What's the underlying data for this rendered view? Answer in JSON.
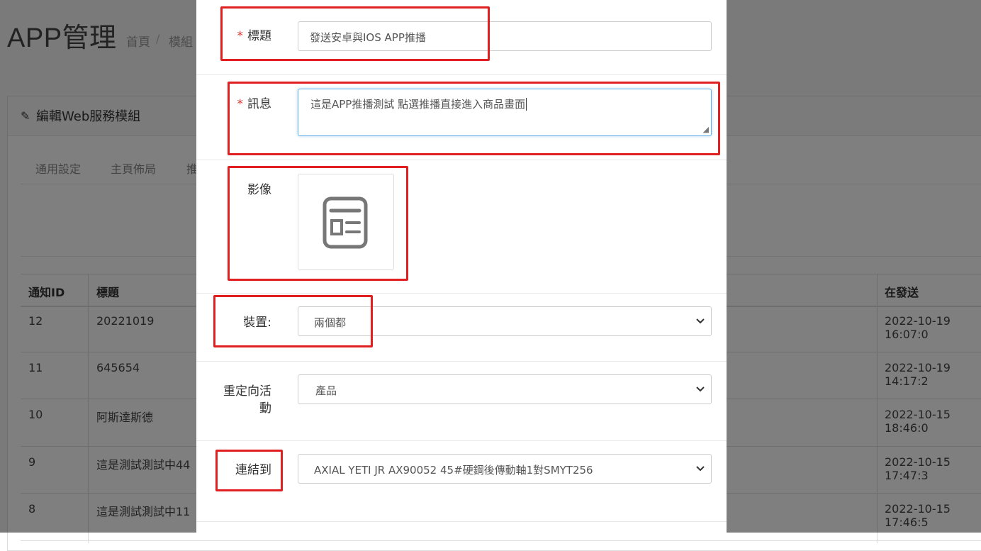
{
  "background": {
    "title": "APP管理",
    "breadcrumb": [
      "首頁",
      "模組"
    ],
    "breadcrumb_sep": "/",
    "panel_title": "編輯Web服務模組",
    "tabs": [
      "通用設定",
      "主頁佈局",
      "推"
    ],
    "table": {
      "headers": [
        "通知ID",
        "標題",
        "在發送"
      ],
      "rows": [
        {
          "id": "12",
          "title": "20221019",
          "sent": "2022-10-19 16:07:0"
        },
        {
          "id": "11",
          "title": "645654",
          "sent": "2022-10-19 14:17:2"
        },
        {
          "id": "10",
          "title": "阿斯達斯德",
          "sent": "2022-10-15 18:46:0"
        },
        {
          "id": "9",
          "title": "這是測試測試中44",
          "sent": "2022-10-15 17:47:3"
        },
        {
          "id": "8",
          "title": "這是測試測試中11",
          "sent": "2022-10-15 17:46:5"
        }
      ]
    }
  },
  "modal": {
    "required_mark": "*",
    "title_label": "標題",
    "title_value": "發送安卓與IOS APP推播",
    "message_label": "訊息",
    "message_value": "這是APP推播測試 點選推播直接進入商品畫面",
    "image_label": "影像",
    "device_label": "裝置:",
    "device_value": "兩個都",
    "redirect_label_line1": "重定向活",
    "redirect_label_line2": "動",
    "redirect_value": "產品",
    "link_label": "連結到",
    "link_value": "AXIAL YETI JR AX90052 45#硬鋼後傳動軸1對SMYT256"
  },
  "colors": {
    "highlight": "#e02020",
    "required": "#d9342b",
    "focus_border": "#66afe9",
    "overlay": "rgba(0,0,0,0.5)"
  },
  "icons": [
    "pencil-icon",
    "image-placeholder-icon",
    "chevron-down-icon",
    "resize-grip-icon"
  ]
}
